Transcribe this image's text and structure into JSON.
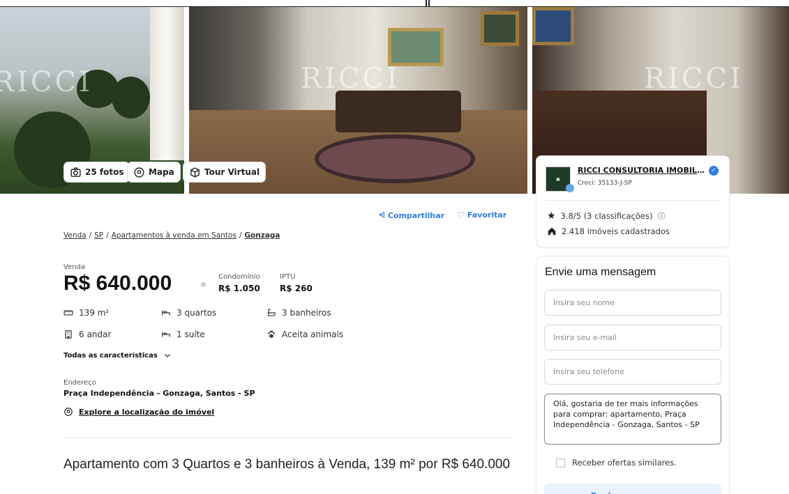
{
  "gallery": {
    "watermark": "RICCI",
    "photos_button": "25 fotos",
    "map_button": "Mapa",
    "tour_button": "Tour Virtual"
  },
  "actions": {
    "share": "Compartilhar",
    "favorite": "Favoritar"
  },
  "breadcrumb": {
    "items": [
      "Venda",
      "SP",
      "Apartamentos à venda em Santos"
    ],
    "current": "Gonzaga",
    "separator": "/"
  },
  "listing": {
    "type_label": "Venda",
    "price": "R$ 640.000",
    "condo_label": "Condomínio",
    "condo_value": "R$ 1.050",
    "iptu_label": "IPTU",
    "iptu_value": "R$ 260",
    "features": [
      {
        "icon": "area-icon",
        "text": "139 m²"
      },
      {
        "icon": "bed-icon",
        "text": "3 quartos"
      },
      {
        "icon": "bath-icon",
        "text": "3 banheiros"
      },
      {
        "icon": "building-icon",
        "text": "6 andar"
      },
      {
        "icon": "bed-icon",
        "text": "1 suíte"
      },
      {
        "icon": "paw-icon",
        "text": "Aceita animais"
      }
    ],
    "all_features_label": "Todas as características",
    "address_label": "Endereço",
    "address": "Praça Independência - Gonzaga, Santos - SP",
    "explore_label": "Explore a localização do imóvel",
    "headline": "Apartamento com 3 Quartos e 3 banheiros à Venda, 139 m² por R$ 640.000"
  },
  "agency": {
    "name": "RICCI CONSULTORIA IMOBILIÁRIA",
    "creci": "Creci: 35133-J-SP",
    "rating": "3.8/5 (3 classificações)",
    "listings": "2.418 imóveis cadastrados"
  },
  "form": {
    "title": "Envie uma mensagem",
    "name_placeholder": "Insira seu nome",
    "email_placeholder": "Insira seu e-mail",
    "phone_placeholder": "Insira seu telefone",
    "message": "Olá, gostaria de ter mais informações para comprar: apartamento, Praça Independência - Gonzaga, Santos - SP",
    "similar_offers": "Receber ofertas similares.",
    "send_button": "Enviar mensagem"
  },
  "colors": {
    "accent": "#2e7ee5"
  }
}
